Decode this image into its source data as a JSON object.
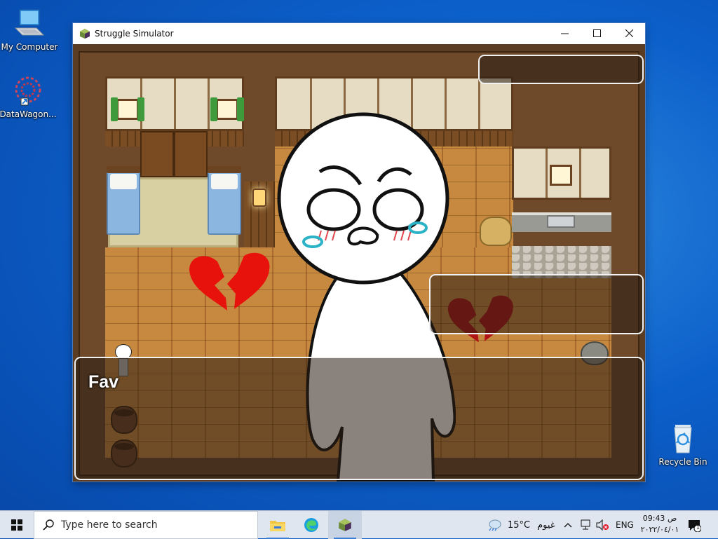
{
  "desktop": {
    "icons": [
      {
        "label": "My Computer"
      },
      {
        "label": "DataWagon..."
      },
      {
        "label": "Recycle Bin"
      }
    ]
  },
  "window": {
    "title": "Struggle Simulator",
    "controls": {
      "minimize": "—",
      "maximize": "☐",
      "close": "✕"
    }
  },
  "game": {
    "message_box": {
      "speaker": "Fav",
      "text": ""
    },
    "top_right_box": {
      "text": ""
    },
    "side_box": {
      "text": ""
    }
  },
  "taskbar": {
    "search_placeholder": "Type here to search",
    "weather": {
      "temp": "15°C",
      "condition": "غيوم"
    },
    "tray": {
      "language": "ENG"
    },
    "clock": {
      "time": "09:43 ص",
      "date": "٢٠٢٢/٠٤/٠١"
    },
    "notification_count": "1"
  },
  "colors": {
    "desktop_bg": "#0c5fc9",
    "heart_red": "#e8120c",
    "taskbar_bg": "#dfe6f0"
  }
}
